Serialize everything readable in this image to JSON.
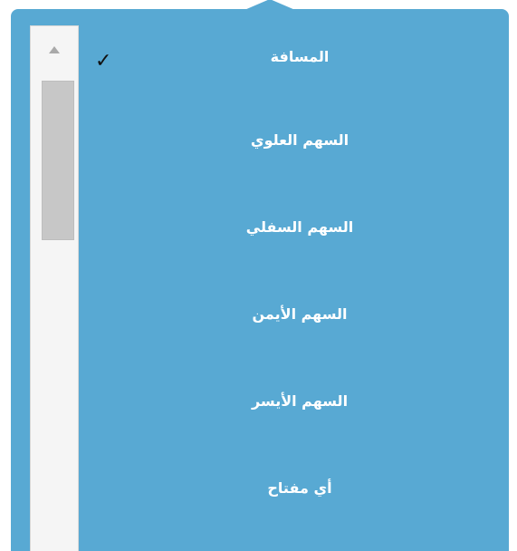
{
  "menu": {
    "selected_check": "✓",
    "items": [
      {
        "label": "المسافة"
      },
      {
        "label": "السهم العلوي"
      },
      {
        "label": "السهم السفلي"
      },
      {
        "label": "السهم الأيمن"
      },
      {
        "label": "السهم الأيسر"
      },
      {
        "label": "أي مفتاح"
      }
    ]
  },
  "colors": {
    "panel_bg": "#58a9d3",
    "scroll_track": "#f5f5f5",
    "scroll_thumb": "#c7c7c7",
    "text": "#ffffff",
    "check": "#111111"
  }
}
